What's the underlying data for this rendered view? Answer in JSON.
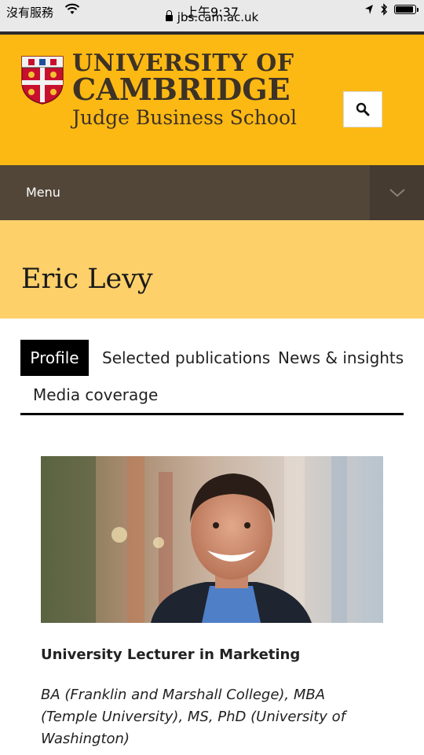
{
  "status_bar": {
    "carrier": "沒有服務",
    "time": "上午9:37",
    "url": "jbs.cam.ac.uk",
    "battery_level": 0.9
  },
  "header": {
    "brand_line1": "UNIVERSITY OF",
    "brand_line2": "CAMBRIDGE",
    "brand_line3": "Judge Business School",
    "search_icon": "search-icon",
    "colors": {
      "header_bg": "#fdb913",
      "menu_bg": "#514638",
      "title_bg": "#fdd06a"
    }
  },
  "menu": {
    "label": "Menu",
    "toggle_icon": "chevron-down-icon"
  },
  "page": {
    "title": "Eric Levy"
  },
  "tabs": [
    {
      "label": "Profile",
      "active": true
    },
    {
      "label": "Selected publications",
      "active": false
    },
    {
      "label": "News & insights",
      "active": false
    },
    {
      "label": "Media coverage",
      "active": false
    }
  ],
  "profile": {
    "job_title": "University Lecturer in Marketing",
    "qualifications": "BA (Franklin and Marshall College), MBA (Temple University), MS, PhD (University of Washington)"
  }
}
